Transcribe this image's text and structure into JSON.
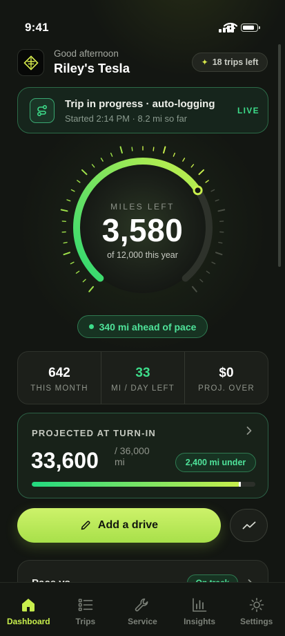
{
  "status_bar": {
    "time": "9:41"
  },
  "header": {
    "greeting": "Good afternoon",
    "car_name": "Riley's Tesla",
    "trips_left": "18 trips left",
    "logo_icon": "diamond-logo-icon"
  },
  "trip": {
    "title": "Trip in progress · auto-logging",
    "subtitle": "Started 2:14 PM · 8.2 mi so far",
    "status": "LIVE",
    "icon": "route-icon"
  },
  "gauge": {
    "label": "MILES LEFT",
    "value": "3,580",
    "subtitle": "of 12,000 this year",
    "fill_fraction": 0.7
  },
  "pace": {
    "label": "340 mi ahead of pace"
  },
  "stats": [
    {
      "value": "642",
      "label": "THIS MONTH",
      "color": "#ffffff"
    },
    {
      "value": "33",
      "label": "MI / DAY LEFT",
      "color": "#3ddc8a"
    },
    {
      "value": "$0",
      "label": "PROJ. OVER",
      "color": "#ffffff"
    }
  ],
  "projection": {
    "title": "PROJECTED AT TURN-IN",
    "value": "33,600",
    "of_value": "/ 36,000",
    "unit": "mi",
    "badge": "2,400 mi under",
    "progress_fraction": 0.933
  },
  "actions": {
    "add_label": "Add a drive",
    "add_icon": "pencil-icon",
    "trend_icon": "trend-chart-icon"
  },
  "pace_card": {
    "title": "Pace vs",
    "badge": "On track"
  },
  "tabs": [
    {
      "label": "Dashboard",
      "icon": "home-icon",
      "active": true
    },
    {
      "label": "Trips",
      "icon": "list-icon",
      "active": false
    },
    {
      "label": "Service",
      "icon": "wrench-icon",
      "active": false
    },
    {
      "label": "Insights",
      "icon": "bar-chart-icon",
      "active": false
    },
    {
      "label": "Settings",
      "icon": "gear-icon",
      "active": false
    }
  ],
  "colors": {
    "accent_lime": "#c8ef4c",
    "accent_green": "#3ddc8a",
    "background": "#131612"
  }
}
